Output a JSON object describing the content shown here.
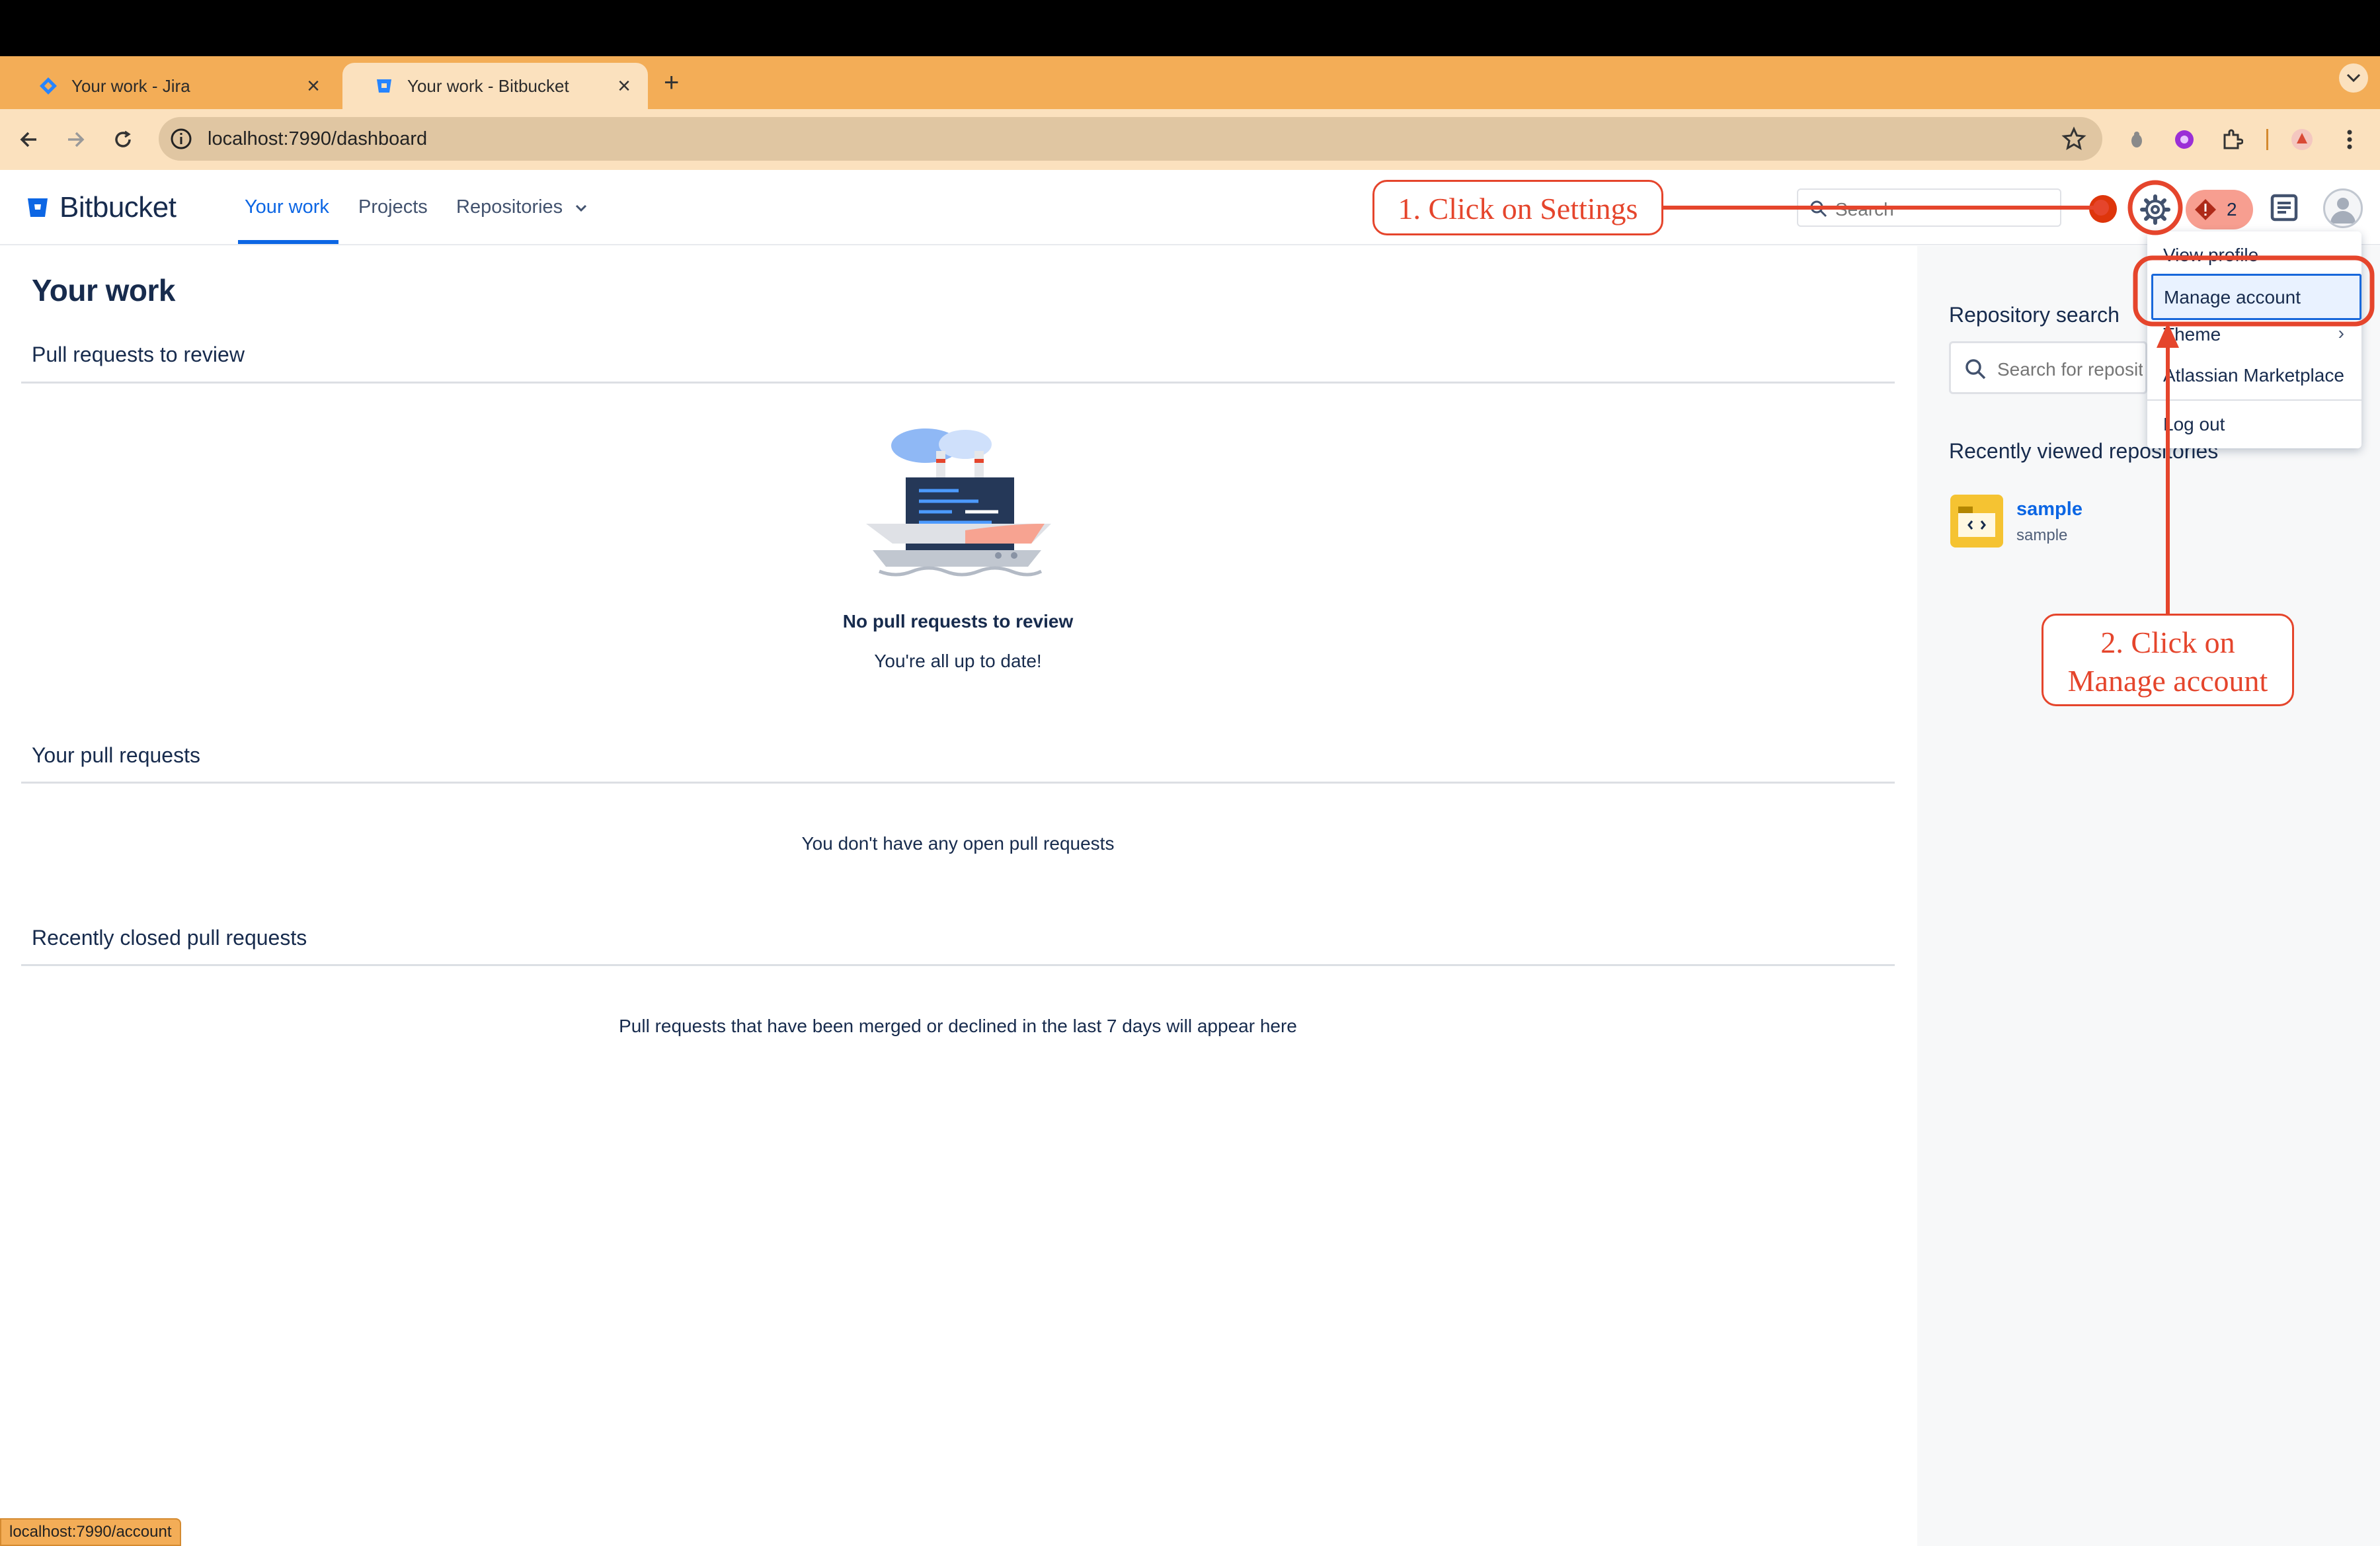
{
  "browser": {
    "tabs": [
      {
        "title": "Your work - Jira",
        "active": false
      },
      {
        "title": "Your work - Bitbucket",
        "active": true
      }
    ],
    "url": "localhost:7990/dashboard",
    "status_url": "localhost:7990/account"
  },
  "header": {
    "brand": "Bitbucket",
    "nav": [
      "Your work",
      "Projects",
      "Repositories"
    ],
    "search_placeholder": "Search",
    "notification_count": "2"
  },
  "main": {
    "title": "Your work",
    "sections": [
      {
        "title": "Pull requests to review",
        "empty_title": "No pull requests to review",
        "empty_subtitle": "You're all up to date!"
      },
      {
        "title": "Your pull requests",
        "empty_text": "You don't have any open pull requests"
      },
      {
        "title": "Recently closed pull requests",
        "empty_text": "Pull requests that have been merged or declined in the last 7 days will appear here"
      }
    ]
  },
  "sidebar": {
    "repo_search_title": "Repository search",
    "repo_search_placeholder": "Search for repositories",
    "recent_title": "Recently viewed repositories",
    "repos": [
      {
        "name": "sample",
        "project": "sample"
      }
    ]
  },
  "dropdown": {
    "items": [
      "View profile",
      "Manage account",
      "Theme",
      "Atlassian Marketplace",
      "Log out"
    ]
  },
  "annotations": {
    "step1": "1. Click on Settings",
    "step2_line1": "2. Click on",
    "step2_line2": "Manage account"
  },
  "colors": {
    "accent": "#0c66e4",
    "annotation": "#e5452c",
    "tabstrip": "#f3ad57"
  }
}
